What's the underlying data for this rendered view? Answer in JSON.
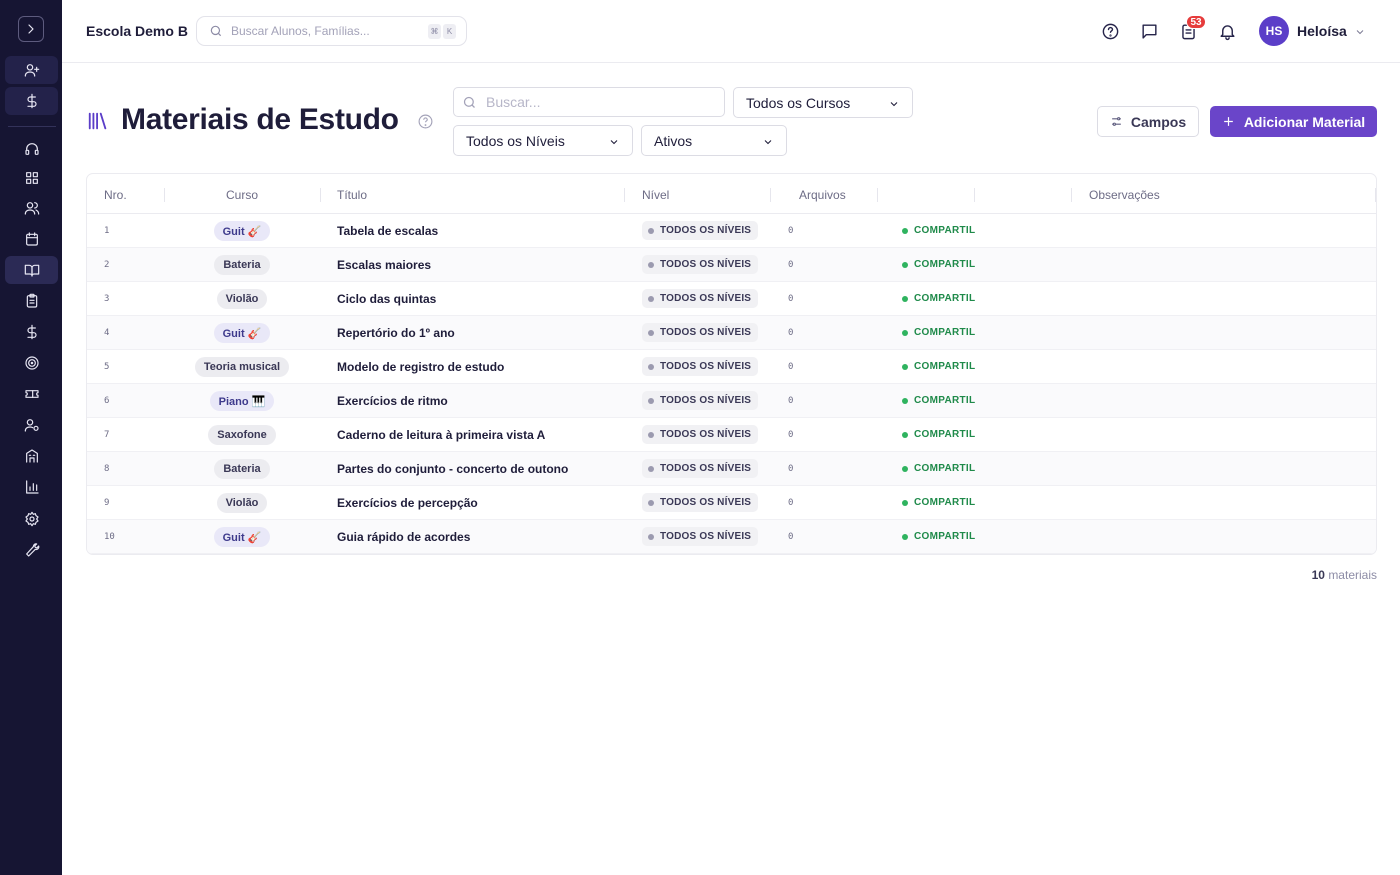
{
  "header": {
    "school_name": "Escola Demo B",
    "search_placeholder": "Buscar Alunos, Famílias...",
    "kbd_cmd": "⌘",
    "kbd_key": "K",
    "notification_count": "53",
    "user_initials": "HS",
    "user_name": "Heloísa"
  },
  "page": {
    "title": "Materiais de Estudo",
    "search_placeholder": "Buscar...",
    "filter_course": "Todos os Cursos",
    "filter_level": "Todos os Níveis",
    "filter_status": "Ativos",
    "fields_button": "Campos",
    "add_button": "Adicionar Material"
  },
  "table": {
    "columns": [
      "Nro.",
      "Curso",
      "Título",
      "Nível",
      "Arquivos",
      "Observações"
    ],
    "rows": [
      {
        "num": "1",
        "course": "Guit 🎸",
        "course_style": "purple",
        "title": "Tabela de escalas",
        "level": "TODOS OS NÍVEIS",
        "files": "0",
        "status": "COMPARTIL"
      },
      {
        "num": "2",
        "course": "Bateria",
        "course_style": "gray",
        "title": "Escalas maiores",
        "level": "TODOS OS NÍVEIS",
        "files": "0",
        "status": "COMPARTIL"
      },
      {
        "num": "3",
        "course": "Violão",
        "course_style": "gray",
        "title": "Ciclo das quintas",
        "level": "TODOS OS NÍVEIS",
        "files": "0",
        "status": "COMPARTIL"
      },
      {
        "num": "4",
        "course": "Guit 🎸",
        "course_style": "purple",
        "title": "Repertório do 1º ano",
        "level": "TODOS OS NÍVEIS",
        "files": "0",
        "status": "COMPARTIL"
      },
      {
        "num": "5",
        "course": "Teoria musical",
        "course_style": "gray",
        "title": "Modelo de registro de estudo",
        "level": "TODOS OS NÍVEIS",
        "files": "0",
        "status": "COMPARTIL"
      },
      {
        "num": "6",
        "course": "Piano 🎹",
        "course_style": "purple",
        "title": "Exercícios de ritmo",
        "level": "TODOS OS NÍVEIS",
        "files": "0",
        "status": "COMPARTIL"
      },
      {
        "num": "7",
        "course": "Saxofone",
        "course_style": "gray",
        "title": "Caderno de leitura à primeira vista A",
        "level": "TODOS OS NÍVEIS",
        "files": "0",
        "status": "COMPARTIL"
      },
      {
        "num": "8",
        "course": "Bateria",
        "course_style": "gray",
        "title": "Partes do conjunto - concerto de outono",
        "level": "TODOS OS NÍVEIS",
        "files": "0",
        "status": "COMPARTIL"
      },
      {
        "num": "9",
        "course": "Violão",
        "course_style": "gray",
        "title": "Exercícios de percepção",
        "level": "TODOS OS NÍVEIS",
        "files": "0",
        "status": "COMPARTIL"
      },
      {
        "num": "10",
        "course": "Guit 🎸",
        "course_style": "purple",
        "title": "Guia rápido de acordes",
        "level": "TODOS OS NÍVEIS",
        "files": "0",
        "status": "COMPARTIL"
      }
    ]
  },
  "footer": {
    "count": "10",
    "count_label": "materiais"
  },
  "sidebar": {
    "icons": [
      "chevron-right-icon",
      "add-user-icon",
      "dollar-icon",
      "headset-icon",
      "dashboard-icon",
      "users-icon",
      "calendar-icon",
      "book-icon",
      "clipboard-icon",
      "dollar-icon",
      "target-icon",
      "ticket-icon",
      "user-settings-icon",
      "building-icon",
      "bar-chart-icon",
      "gear-icon",
      "wrench-icon"
    ]
  },
  "colors": {
    "sidebar_bg": "#161533",
    "accent": "#6a45c9",
    "status_green": "#1f8a4a",
    "badge_red": "#e63c3c"
  }
}
